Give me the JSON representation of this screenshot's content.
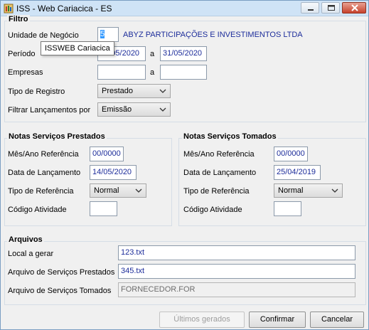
{
  "window": {
    "title": "ISS - Web Cariacica - ES"
  },
  "filtro": {
    "title": "Filtro",
    "unidade_label": "Unidade de Negócio",
    "unidade_value": "5",
    "unidade_name": "ABYZ PARTICIPAÇÕES E INVESTIMENTOS LTDA",
    "tooltip": "ISSWEB Cariacica",
    "periodo_label": "Período",
    "periodo_from": "01/05/2020",
    "periodo_sep": "a",
    "periodo_to": "31/05/2020",
    "empresas_label": "Empresas",
    "empresas_from": "",
    "empresas_sep": "a",
    "empresas_to": "",
    "tipo_registro_label": "Tipo de Registro",
    "tipo_registro_value": "Prestado",
    "filtrar_label": "Filtrar Lançamentos por",
    "filtrar_value": "Emissão"
  },
  "prestados": {
    "title": "Notas Serviços Prestados",
    "mes_label": "Mês/Ano Referência",
    "mes_value": "00/0000",
    "data_label": "Data de Lançamento",
    "data_value": "14/05/2020",
    "tipo_label": "Tipo de Referência",
    "tipo_value": "Normal",
    "codigo_label": "Código Atividade",
    "codigo_value": ""
  },
  "tomados": {
    "title": "Notas Serviços Tomados",
    "mes_label": "Mês/Ano Referência",
    "mes_value": "00/0000",
    "data_label": "Data de Lançamento",
    "data_value": "25/04/2019",
    "tipo_label": "Tipo de Referência",
    "tipo_value": "Normal",
    "codigo_label": "Código Atividade",
    "codigo_value": ""
  },
  "arquivos": {
    "title": "Arquivos",
    "local_label": "Local a gerar",
    "local_value": "123.txt",
    "prestados_label": "Arquivo de Serviços Prestados",
    "prestados_value": "345.txt",
    "tomados_label": "Arquivo de Serviços Tomados",
    "tomados_value": "FORNECEDOR.FOR"
  },
  "buttons": {
    "ultimos": "Últimos gerados",
    "confirmar": "Confirmar",
    "cancelar": "Cancelar"
  },
  "colors": {
    "field_text": "#1c2c9a",
    "titlebar": "#cfe3f6",
    "close": "#c7412b"
  },
  "icons": [
    "app-icon",
    "minimize-icon",
    "maximize-icon",
    "close-icon",
    "chevron-down-icon"
  ]
}
